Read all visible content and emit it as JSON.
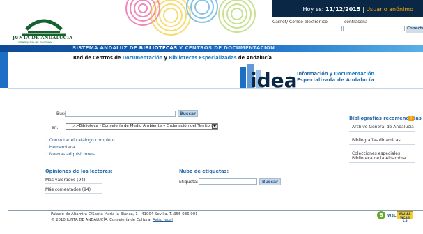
{
  "header": {
    "date_prefix": "Hoy es:",
    "date": "11/12/2015",
    "separator": "|",
    "user": "Usuario anónimo",
    "login_label": "Carnet/ Correo electrónico",
    "password_label": "contraseña",
    "connect_label": "Conecta"
  },
  "logo": {
    "line1": "JUNTA DE ANDALUCIA",
    "line2": "CONSEJERÍA DE CULTURA"
  },
  "band": {
    "part1": "SISTEMA ANDALUZ DE ",
    "part2": "BIBLIOTECAS",
    "part3": " Y ",
    "part4": "CENTROS DE DOCUMENTACIÓN"
  },
  "network": {
    "part1": "Red de Centros de ",
    "part2": "Documentación",
    "part3": " y ",
    "part4": "Bibliotecas Especializadas",
    "part5": " de Andalucía"
  },
  "idea": {
    "logo": "idea",
    "line1a": "Información y ",
    "line1b": "Documentación",
    "line2": "Especializada de Andalucía"
  },
  "search": {
    "label": "Buscar:",
    "value": "",
    "button": "Buscar",
    "en_label": "en:",
    "selected": ">>Biblioteca - Consejería de Medio Ambiente y Ordenación del Territorio"
  },
  "links": [
    "Consultar el catálogo completo",
    "Hemeroteca",
    "Nuevas adquisiciones"
  ],
  "opinions": {
    "title": "Opiniones de los lectores:",
    "items": [
      "Más valorados (94)",
      "Más comentados (94)"
    ]
  },
  "tags": {
    "title": "Nube de etiquetas:",
    "label": "Etiqueta:",
    "button": "Buscar"
  },
  "bibliographies": {
    "title": "Bibliografías recomendadas",
    "rss_icon": "rss-icon",
    "items": [
      "Archivo General de Andalucía",
      "Bibliografías dinámicas",
      "Colecciones especiales Biblioteca de la Alhambra"
    ]
  },
  "footer": {
    "address": "Palacio de Altamira C/Santa María la Blanca, 1 - 41004 Sevilla. T.:955 036 001",
    "copyright": "© 2010 JUNTA DE ANDALUCÍA. Consejería de Cultura.",
    "legal_link": "Aviso legal",
    "badge_b": "B",
    "badge_w3c": "W3C",
    "badge_wai": "WAI-AA WCAG 1.0"
  },
  "colors": {
    "navy": "#0a2846",
    "band_blue": "#1d6fc6",
    "link_blue": "#2a5d8c",
    "heading_blue": "#2c6da8",
    "anon_orange": "#f2a900",
    "junta_green": "#17612e"
  }
}
